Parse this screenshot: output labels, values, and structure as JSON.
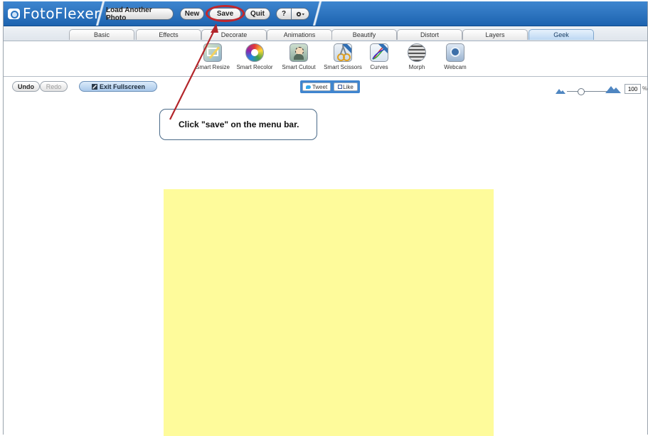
{
  "app": {
    "title": "FotoFlexer"
  },
  "menubar": {
    "load_label": "Load Another Photo",
    "new_label": "New",
    "save_label": "Save",
    "quit_label": "Quit",
    "help_label": "?",
    "settings_icon": "gear-icon"
  },
  "tabs": [
    {
      "label": "Basic"
    },
    {
      "label": "Effects"
    },
    {
      "label": "Decorate"
    },
    {
      "label": "Animations"
    },
    {
      "label": "Beautify"
    },
    {
      "label": "Distort"
    },
    {
      "label": "Layers"
    },
    {
      "label": "Geek",
      "active": true
    }
  ],
  "tools": [
    {
      "label": "Smart Resize",
      "icon": "smart-resize-icon"
    },
    {
      "label": "Smart Recolor",
      "icon": "smart-recolor-icon"
    },
    {
      "label": "Smart Cutout",
      "icon": "smart-cutout-icon"
    },
    {
      "label": "Smart Scissors",
      "icon": "smart-scissors-icon"
    },
    {
      "label": "Curves",
      "icon": "curves-icon"
    },
    {
      "label": "Morph",
      "icon": "morph-icon"
    },
    {
      "label": "Webcam",
      "icon": "webcam-icon"
    }
  ],
  "actions": {
    "undo_label": "Undo",
    "redo_label": "Redo",
    "exit_fullscreen_label": "Exit Fullscreen"
  },
  "social": {
    "tweet_label": "Tweet",
    "like_label": "Like"
  },
  "zoom": {
    "value": "100",
    "unit": "%"
  },
  "callout": {
    "text": "Click \"save\" on the menu bar."
  },
  "colors": {
    "menubar": "#2a74c0",
    "annotation": "#c1272d",
    "photo": "#fefb9b"
  }
}
